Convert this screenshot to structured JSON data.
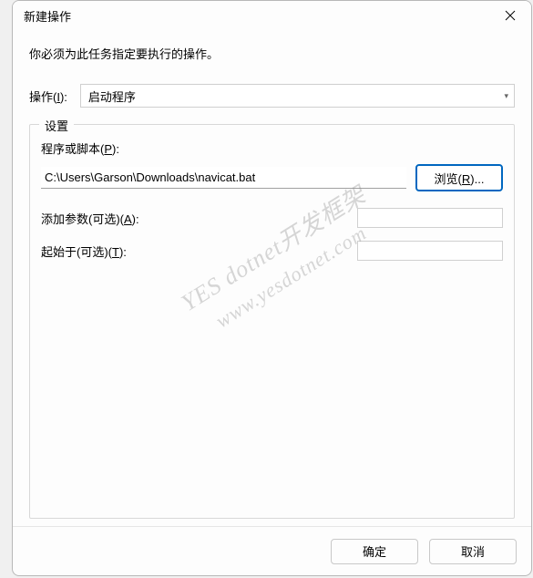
{
  "title": "新建操作",
  "instruction": "你必须为此任务指定要执行的操作。",
  "action": {
    "label": "操作(I):",
    "selected": "启动程序"
  },
  "settings": {
    "legend": "设置",
    "scriptLabel": "程序或脚本(P):",
    "scriptValue": "C:\\Users\\Garson\\Downloads\\navicat.bat",
    "browse": "浏览(R)...",
    "argsLabel": "添加参数(可选)(A):",
    "argsValue": "",
    "startInLabel": "起始于(可选)(T):",
    "startInValue": ""
  },
  "footer": {
    "ok": "确定",
    "cancel": "取消"
  },
  "watermark": {
    "line1": "YES dotnet开发框架",
    "line2": "www.yesdotnet.com"
  }
}
